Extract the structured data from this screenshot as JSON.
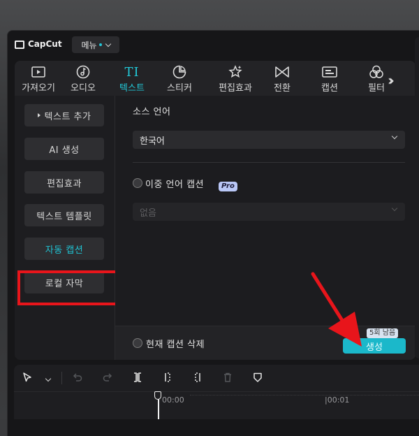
{
  "app": {
    "name": "CapCut",
    "menu_label": "메뉴"
  },
  "toolbar": {
    "items": [
      {
        "label": "가져오기",
        "icon": "media-import-icon"
      },
      {
        "label": "오디오",
        "icon": "audio-icon"
      },
      {
        "label": "텍스트",
        "icon": "text-icon",
        "active": true
      },
      {
        "label": "스티커",
        "icon": "sticker-icon"
      },
      {
        "label": "편집효과",
        "icon": "effects-icon"
      },
      {
        "label": "전환",
        "icon": "transition-icon"
      },
      {
        "label": "캡션",
        "icon": "caption-icon"
      },
      {
        "label": "필터",
        "icon": "filter-icon"
      }
    ],
    "more": "expand-icon"
  },
  "sidebar": {
    "items": [
      {
        "label": "텍스트 추가"
      },
      {
        "label": "AI 생성"
      },
      {
        "label": "편집효과"
      },
      {
        "label": "텍스트 템플릿"
      },
      {
        "label": "자동 캡션",
        "active": true
      },
      {
        "label": "로컬 자막"
      }
    ]
  },
  "captions": {
    "source_language_label": "소스 언어",
    "source_language_value": "한국어",
    "bilingual_label": "이중 언어 캡션",
    "pro_badge": "Pro",
    "bilingual_placeholder": "없음",
    "delete_current_label": "현재 캡션 삭제",
    "generate_label": "생성",
    "remaining_badge": "5회 남음"
  },
  "timeline": {
    "time_start": "00:00",
    "time_next": "|00:01"
  },
  "colors": {
    "accent": "#22c9d9",
    "highlight_box": "#e8151b",
    "arrow": "#e8151b"
  }
}
